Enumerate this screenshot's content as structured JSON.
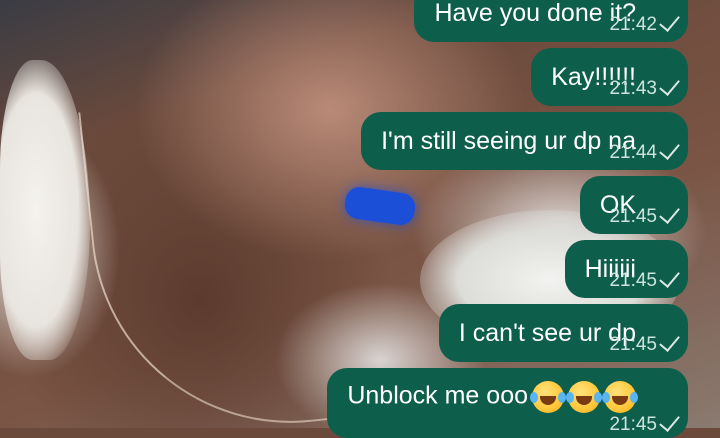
{
  "messages": [
    {
      "text": "Have you done it?",
      "time": "21:42",
      "status": "sent-check-icon"
    },
    {
      "text": "Kay!!!!!!",
      "time": "21:43",
      "status": "sent-check-icon"
    },
    {
      "text": "I'm still seeing ur dp na",
      "time": "21:44",
      "status": "sent-check-icon"
    },
    {
      "text": "OK",
      "time": "21:45",
      "status": "sent-check-icon"
    },
    {
      "text": "Hiiiiii",
      "time": "21:45",
      "status": "sent-check-icon"
    },
    {
      "text": "I can't see ur dp",
      "time": "21:45",
      "status": "sent-check-icon"
    },
    {
      "text": "Unblock me ooo",
      "time": "21:45",
      "status": "sent-check-icon",
      "emoji": [
        "face-with-tears-of-joy-icon",
        "face-with-tears-of-joy-icon",
        "face-with-tears-of-joy-icon"
      ]
    }
  ],
  "colors": {
    "bubble": "#0e5e4c",
    "text": "#ffffff",
    "meta": "#cfe4dc"
  }
}
